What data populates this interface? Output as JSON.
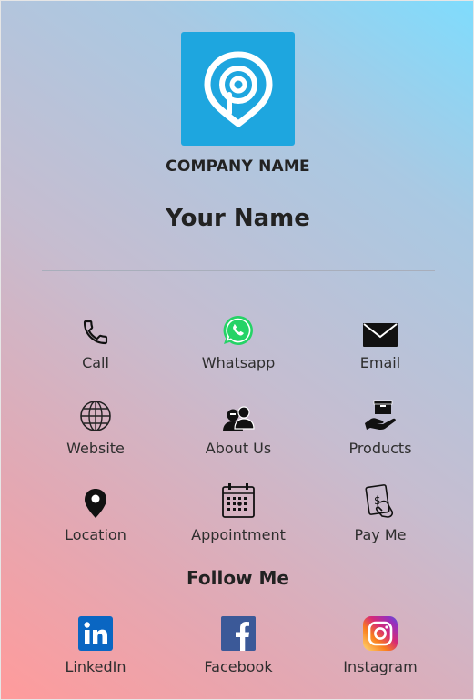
{
  "header": {
    "company_name": "COMPANY NAME",
    "person_name": "Your Name"
  },
  "actions": [
    {
      "label": "Call",
      "icon": "phone-icon"
    },
    {
      "label": "Whatsapp",
      "icon": "whatsapp-icon"
    },
    {
      "label": "Email",
      "icon": "envelope-icon"
    },
    {
      "label": "Website",
      "icon": "globe-icon"
    },
    {
      "label": "About Us",
      "icon": "people-icon"
    },
    {
      "label": "Products",
      "icon": "hand-box-icon"
    },
    {
      "label": "Location",
      "icon": "map-pin-icon"
    },
    {
      "label": "Appointment",
      "icon": "calendar-icon"
    },
    {
      "label": "Pay Me",
      "icon": "payment-icon"
    }
  ],
  "follow": {
    "title": "Follow Me",
    "links": [
      {
        "label": "LinkedIn",
        "icon": "linkedin-icon",
        "color": "#0a66c2"
      },
      {
        "label": "Facebook",
        "icon": "facebook-icon",
        "color": "#3b5998"
      },
      {
        "label": "Instagram",
        "icon": "instagram-icon",
        "color": "#d62976"
      }
    ]
  },
  "colors": {
    "logo_background": "#1ea6df",
    "gradient_top": "#7fdcfd",
    "gradient_bottom": "#ff9b9b",
    "whatsapp_green": "#25d366"
  }
}
